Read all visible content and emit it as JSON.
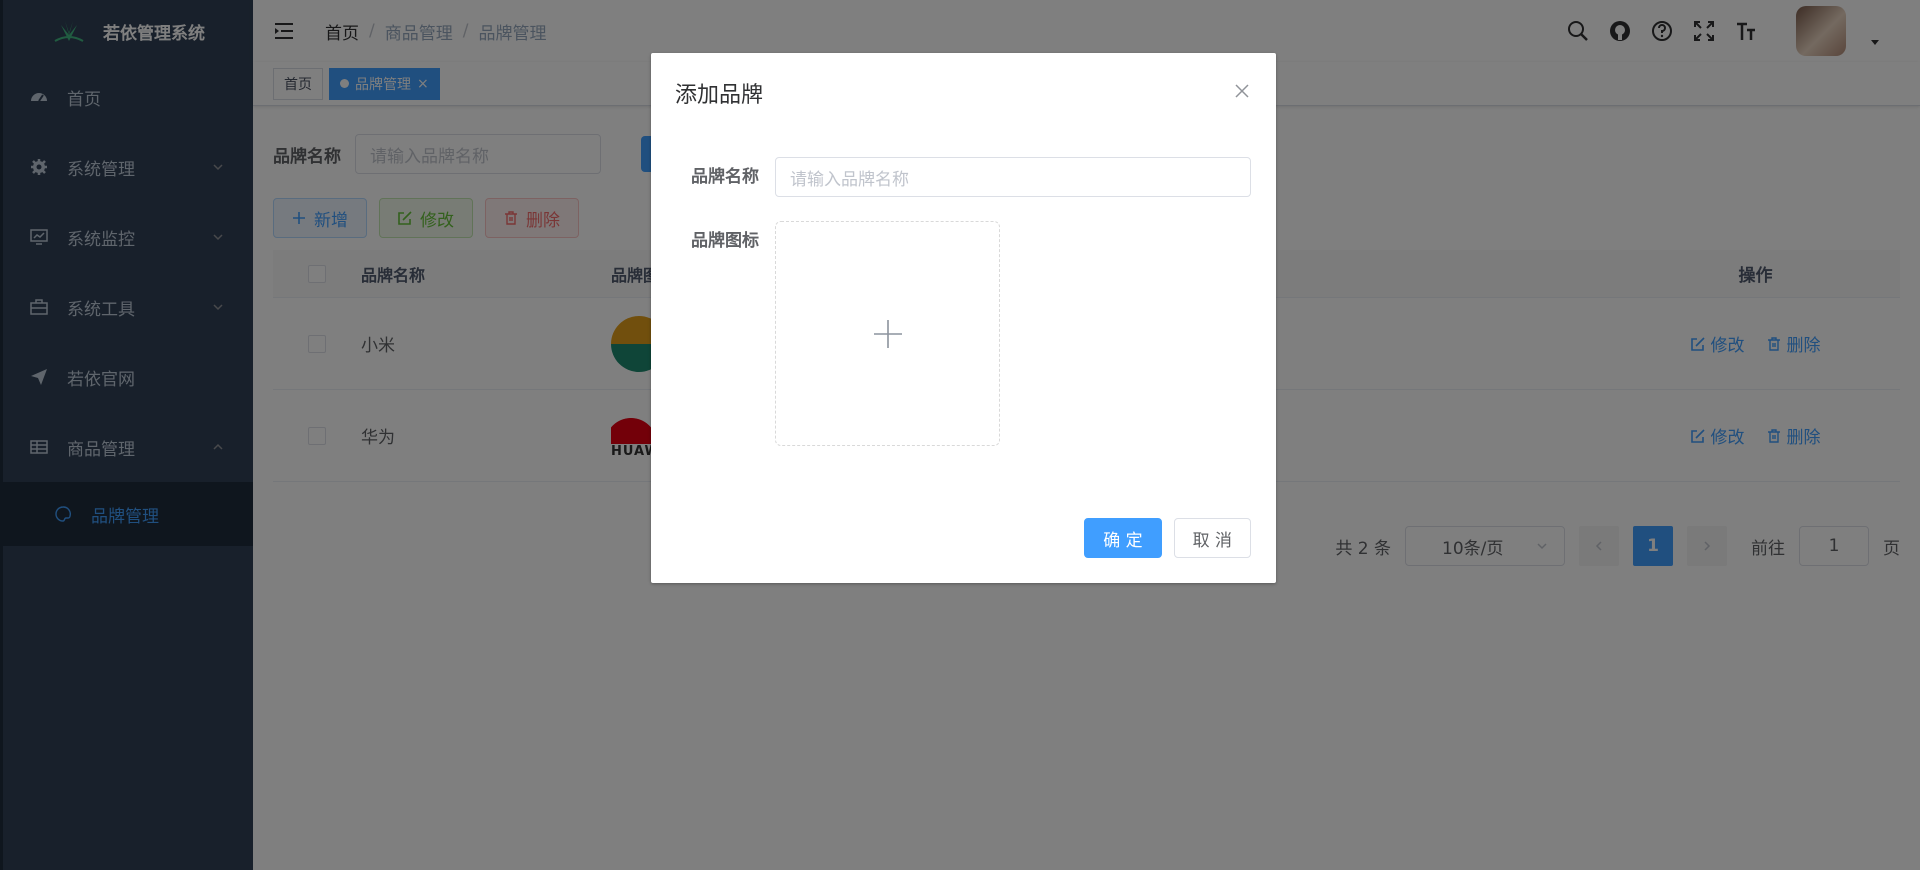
{
  "app": {
    "title": "若依管理系统"
  },
  "sidebar": {
    "items": [
      {
        "label": "首页",
        "icon": "dashboard-icon"
      },
      {
        "label": "系统管理",
        "icon": "gear-icon",
        "arrow": "down"
      },
      {
        "label": "系统监控",
        "icon": "monitor-icon",
        "arrow": "down"
      },
      {
        "label": "系统工具",
        "icon": "toolbox-icon",
        "arrow": "down"
      },
      {
        "label": "若依官网",
        "icon": "paper-plane-icon"
      },
      {
        "label": "商品管理",
        "icon": "table-icon",
        "arrow": "up"
      }
    ],
    "sub_item": {
      "label": "品牌管理",
      "icon": "palette-icon"
    }
  },
  "breadcrumb": {
    "home": "首页",
    "sep": "/",
    "level1": "商品管理",
    "level2": "品牌管理"
  },
  "tags": {
    "home": "首页",
    "active": "品牌管理",
    "close": "×"
  },
  "search": {
    "label": "品牌名称",
    "placeholder": "请输入品牌名称"
  },
  "toolbar": {
    "add": "新增",
    "edit": "修改",
    "delete": "删除"
  },
  "table": {
    "columns": {
      "name": "品牌名称",
      "logo": "品牌图",
      "ops": "操作"
    },
    "rows": [
      {
        "name": "小米"
      },
      {
        "name": "华为",
        "logo_text": "HUAW"
      }
    ],
    "op_edit": "修改",
    "op_delete": "删除"
  },
  "pagination": {
    "total": "共 2 条",
    "size": "10条/页",
    "current": "1",
    "goto": "前往",
    "goto_value": "1",
    "page": "页"
  },
  "dialog": {
    "title": "添加品牌",
    "name_label": "品牌名称",
    "name_placeholder": "请输入品牌名称",
    "icon_label": "品牌图标",
    "confirm": "确 定",
    "cancel": "取 消"
  },
  "colors": {
    "sidebar": "#304156",
    "primary": "#409eff",
    "success": "#67c23a",
    "danger": "#f56c6c"
  }
}
